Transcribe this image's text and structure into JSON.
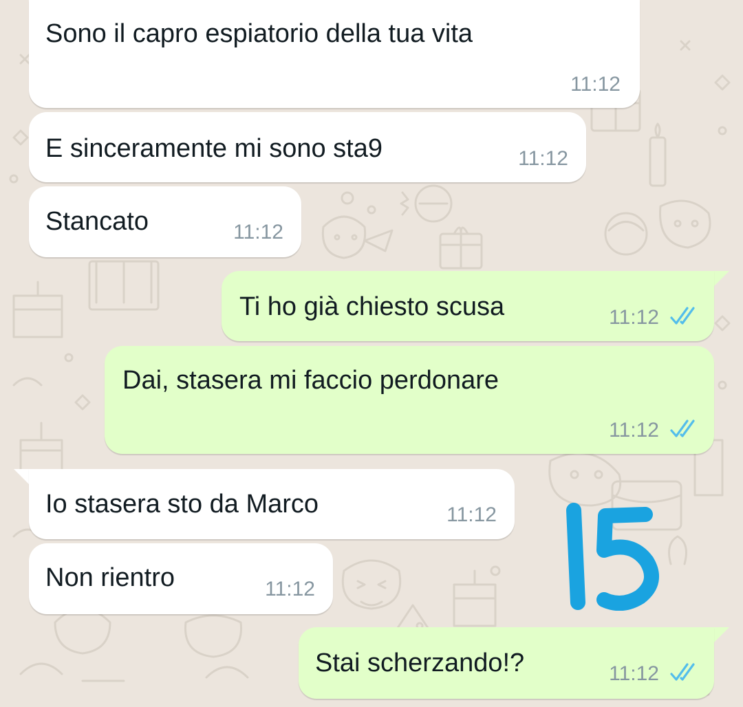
{
  "chat": {
    "messages": [
      {
        "dir": "in",
        "text": "Sono il capro espiatorio della tua vita",
        "time": "11:12"
      },
      {
        "dir": "in",
        "text": "E sinceramente mi sono sta9",
        "time": "11:12"
      },
      {
        "dir": "in",
        "text": "Stancato",
        "time": "11:12"
      },
      {
        "dir": "out",
        "text": "Ti ho già chiesto scusa",
        "time": "11:12",
        "status": "read"
      },
      {
        "dir": "out",
        "text": "Dai, stasera mi faccio perdonare",
        "time": "11:12",
        "status": "read"
      },
      {
        "dir": "in",
        "text": "Io stasera sto da Marco",
        "time": "11:12"
      },
      {
        "dir": "in",
        "text": "Non rientro",
        "time": "11:12"
      },
      {
        "dir": "out",
        "text": "Stai scherzando!?",
        "time": "11:12",
        "status": "read"
      }
    ]
  },
  "annotation": {
    "label": "15",
    "color": "#1aa3e0"
  },
  "colors": {
    "wallpaper": "#ece5dd",
    "incoming_bubble": "#ffffff",
    "outgoing_bubble": "#e2ffc9",
    "time_text": "#8696a0",
    "read_ticks": "#53bdeb"
  }
}
